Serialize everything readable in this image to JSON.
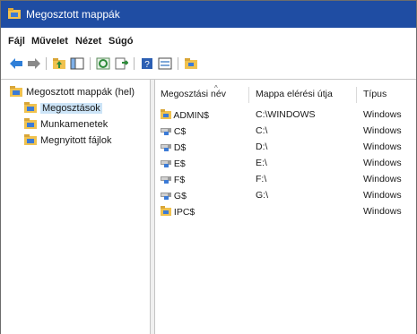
{
  "window": {
    "title": "Megosztott mappák"
  },
  "menu": [
    "Fájl",
    "Művelet",
    "Nézet",
    "Súgó"
  ],
  "toolbar": {
    "buttons": [
      "back-arrow-icon",
      "forward-arrow-icon",
      "up-folder-icon",
      "show-hide-tree-icon",
      "refresh-icon",
      "export-list-icon",
      "help-icon",
      "properties-icon",
      "new-share-icon"
    ]
  },
  "tree": {
    "root": "Megosztott mappák (hel)",
    "children": [
      "Megosztások",
      "Munkamenetek",
      "Megnyitott fájlok"
    ],
    "selected_index": 0
  },
  "list": {
    "columns": [
      "Megosztási név",
      "Mappa elérési útja",
      "Típus"
    ],
    "rows": [
      {
        "name": "ADMIN$",
        "path": "C:\\WINDOWS",
        "type": "Windows",
        "icon": "shared-folder-icon"
      },
      {
        "name": "C$",
        "path": "C:\\",
        "type": "Windows",
        "icon": "shared-drive-icon"
      },
      {
        "name": "D$",
        "path": "D:\\",
        "type": "Windows",
        "icon": "shared-drive-icon"
      },
      {
        "name": "E$",
        "path": "E:\\",
        "type": "Windows",
        "icon": "shared-drive-icon"
      },
      {
        "name": "F$",
        "path": "F:\\",
        "type": "Windows",
        "icon": "shared-drive-icon"
      },
      {
        "name": "G$",
        "path": "G:\\",
        "type": "Windows",
        "icon": "shared-drive-icon"
      },
      {
        "name": "IPC$",
        "path": "",
        "type": "Windows",
        "icon": "shared-folder-icon"
      }
    ]
  },
  "colors": {
    "titlebar": "#1f4da3",
    "selection": "#cce4f7",
    "folder": "#e8b64a"
  }
}
